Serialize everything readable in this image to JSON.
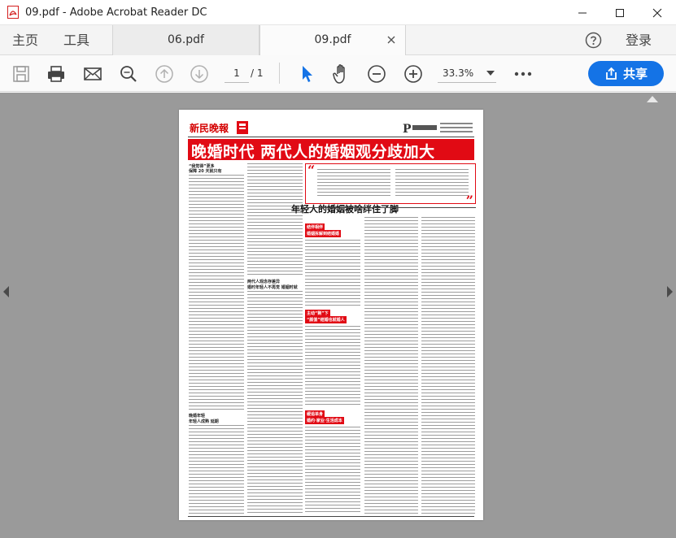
{
  "window": {
    "title": "09.pdf - Adobe Acrobat Reader DC",
    "app_icon": "acrobat-icon",
    "controls": [
      "minimize-icon",
      "maximize-icon",
      "close-icon"
    ]
  },
  "menubar": {
    "home_label": "主页",
    "tools_label": "工具",
    "tabs": [
      {
        "label": "06.pdf",
        "active": false
      },
      {
        "label": "09.pdf",
        "active": true
      }
    ],
    "help_icon": "help-icon",
    "signin_label": "登录"
  },
  "toolbar": {
    "icons": [
      "save-icon",
      "print-icon",
      "email-icon",
      "search-icon",
      "page-up-icon",
      "page-down-icon",
      "select-cursor-icon",
      "hand-tool-icon",
      "zoom-out-icon",
      "zoom-in-icon",
      "zoom-dropdown-icon",
      "more-icon"
    ],
    "page_current": "1",
    "page_total": "/ 1",
    "zoom_value": "33.3%",
    "share_label": "共享",
    "share_icon": "share-icon",
    "accent_color": "#1473e6"
  },
  "document": {
    "paper_name": "新民晚報",
    "headline": "晚婚时代  两代人的婚姻观分歧加大",
    "feature_title": "年轻人的婚姻被啥绊住了脚",
    "left_subhead_1": "“我觉得”更多",
    "left_subhead_2": "保障 20 天就只有",
    "left_subhead_3": "晚婚年轻",
    "left_subhead_4": "年轻人成熟 延期",
    "middle_subhead": "两代人观念存差异",
    "middle_subhead_2": "婚时年轻人不再觉 婚姻时就",
    "red_labels": [
      "结伴相伴",
      "主动“剩”下",
      "缓追单身"
    ],
    "red_label_subs": [
      "婚姻拆解到结婚婚",
      "“颜值”结婚也就婚人",
      "婚约·家业·生活成本"
    ],
    "headline_color": "#e10a14"
  }
}
